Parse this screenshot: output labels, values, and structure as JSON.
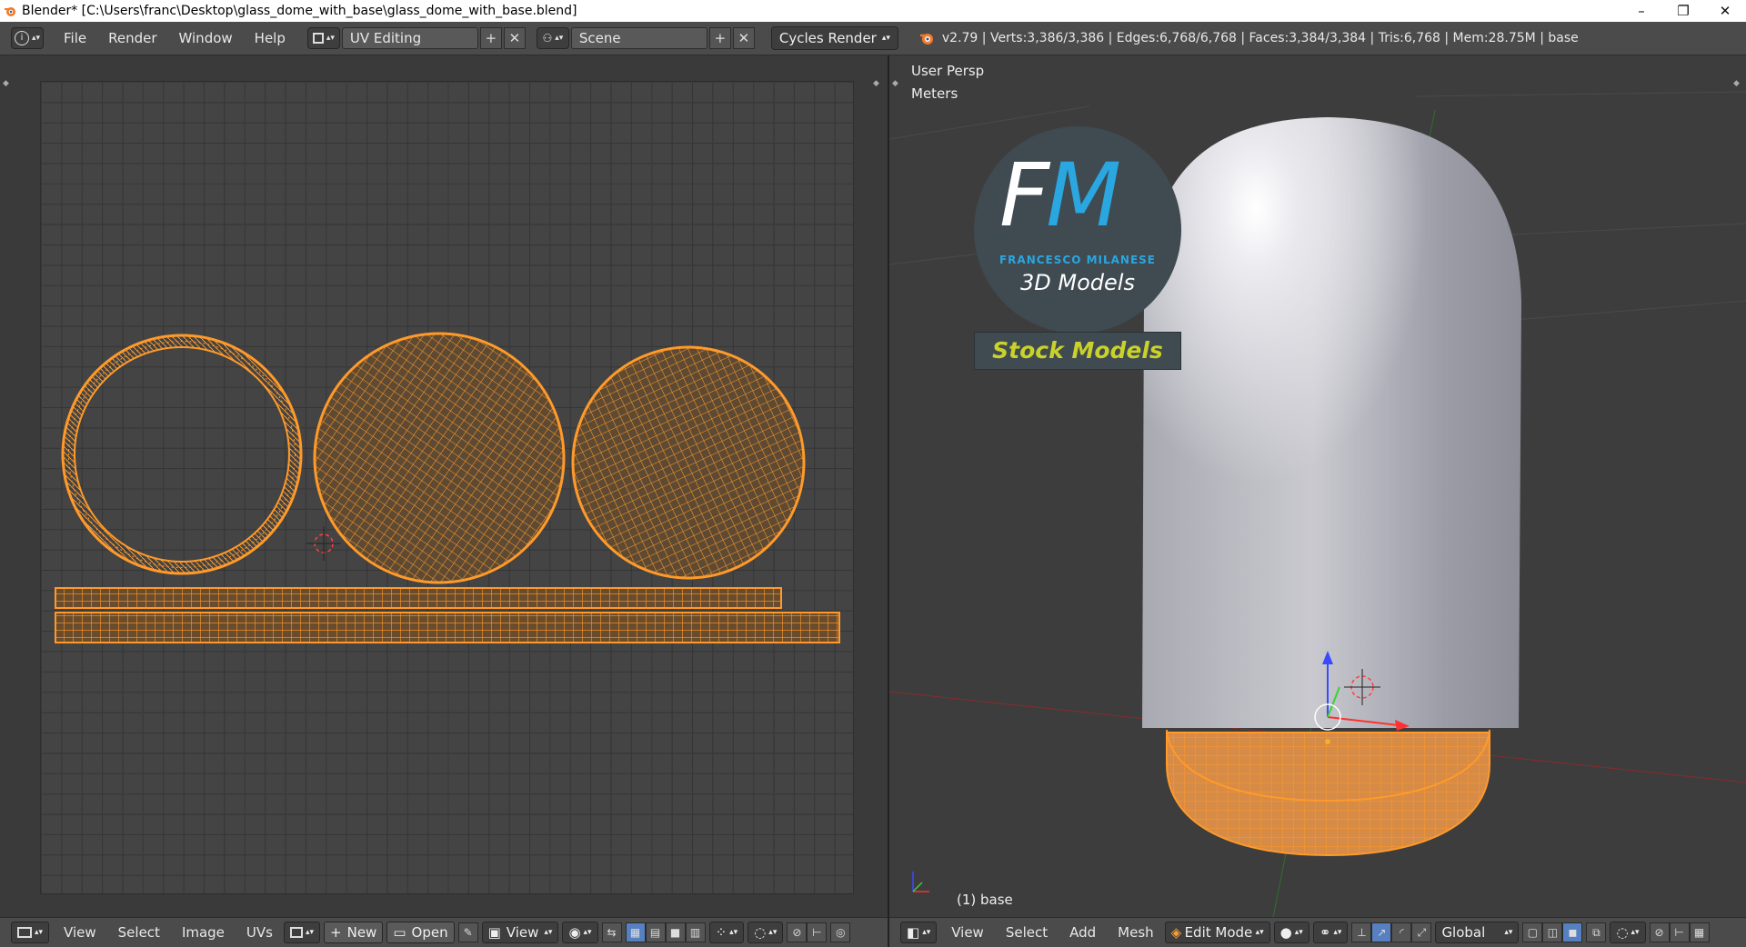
{
  "window": {
    "title": "Blender* [C:\\Users\\franc\\Desktop\\glass_dome_with_base\\glass_dome_with_base.blend]",
    "minimize": "–",
    "maximize": "❐",
    "close": "✕"
  },
  "topbar": {
    "menus": [
      "File",
      "Render",
      "Window",
      "Help"
    ],
    "layout_name": "UV Editing",
    "scene_name": "Scene",
    "render_engine": "Cycles Render",
    "stats": "v2.79 | Verts:3,386/3,386 | Edges:6,768/6,768 | Faces:3,384/3,384 | Tris:6,768 | Mem:28.75M | base"
  },
  "viewport": {
    "view_label": "User Persp",
    "units_label": "Meters",
    "object_label": "(1) base",
    "logo": {
      "initials": "FM",
      "name": "FRANCESCO MILANESE",
      "tagline": "3D Models",
      "banner": "Stock Models"
    }
  },
  "uv_bottombar": {
    "menus": [
      "View",
      "Select",
      "Image",
      "UVs"
    ],
    "new_label": "New",
    "open_label": "Open",
    "view_label": "View"
  },
  "view3d_bottombar": {
    "menus": [
      "View",
      "Select",
      "Add",
      "Mesh"
    ],
    "mode": "Edit Mode",
    "orientation": "Global"
  },
  "colors": {
    "accent_orange": "#ff9a2a",
    "logo_blue": "#2aa6e0",
    "banner_yellow": "#c9d12a",
    "selected_toggle": "#5680c2"
  }
}
